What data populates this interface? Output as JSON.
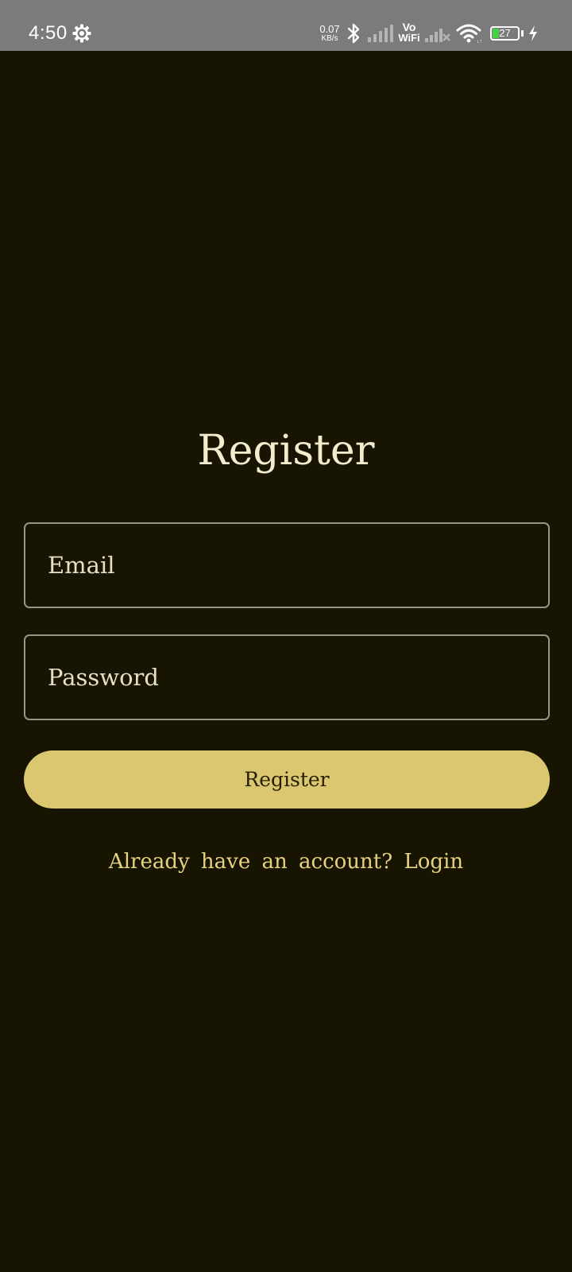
{
  "status_bar": {
    "time": "4:50",
    "net_speed_value": "0.07",
    "net_speed_unit": "KB/s",
    "vowifi_top": "Vo",
    "vowifi_bottom": "WiFi",
    "battery_level": "27",
    "icons": [
      "settings-gear-icon",
      "bluetooth-icon",
      "signal-icon",
      "vowifi-icon",
      "no-signal-icon",
      "wifi-icon",
      "battery-icon",
      "charging-icon"
    ]
  },
  "page": {
    "title": "Register",
    "email_placeholder": "Email",
    "password_placeholder": "Password",
    "register_button": "Register",
    "login_link": "Already have an account? Login"
  },
  "colors": {
    "background": "#181402",
    "accent": "#dbc76f",
    "link": "#e7d27e",
    "title": "#f3ebcd",
    "status_bar": "#7b7b7b"
  }
}
